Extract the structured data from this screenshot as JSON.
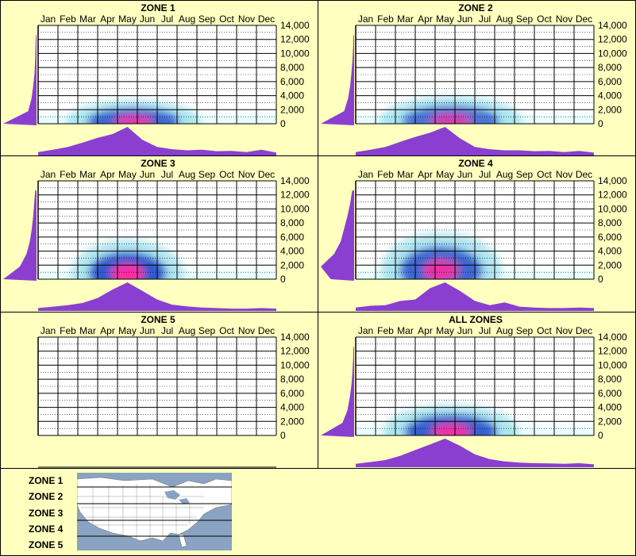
{
  "chart_data": [
    {
      "type": "heatmap",
      "title": "ZONE 1",
      "x_categories": [
        "Jan",
        "Feb",
        "Mar",
        "Apr",
        "May",
        "Jun",
        "Jul",
        "Aug",
        "Sep",
        "Oct",
        "Nov",
        "Dec"
      ],
      "y_ticks": [
        "14,000",
        "12,000",
        "10,000",
        "8,000",
        "6,000",
        "4,000",
        "2,000",
        "0"
      ],
      "ylim": [
        0,
        14000
      ],
      "hot_spot": {
        "month": 4.8,
        "value": 300,
        "intensity": 0.9,
        "spread_month": 1.8,
        "spread_value": 700
      },
      "top_marginal": [
        0.12,
        0.2,
        0.3,
        0.45,
        0.62,
        0.75,
        1.0,
        0.55,
        0.3,
        0.22,
        0.18,
        0.2,
        0.15,
        0.16,
        0.12,
        0.2,
        0.1
      ],
      "side_marginal": [
        1.0,
        0.25,
        0.15,
        0.1,
        0.06,
        0.04,
        0.03,
        0.02
      ]
    },
    {
      "type": "heatmap",
      "title": "ZONE 2",
      "x_categories": [
        "Jan",
        "Feb",
        "Mar",
        "Apr",
        "May",
        "Jun",
        "Jul",
        "Aug",
        "Sep",
        "Oct",
        "Nov",
        "Dec"
      ],
      "y_ticks": [
        "14,000",
        "12,000",
        "10,000",
        "8,000",
        "6,000",
        "4,000",
        "2,000",
        "0"
      ],
      "ylim": [
        0,
        14000
      ],
      "hot_spot": {
        "month": 4.8,
        "value": 400,
        "intensity": 0.8,
        "spread_month": 1.9,
        "spread_value": 900
      },
      "top_marginal": [
        0.12,
        0.2,
        0.3,
        0.48,
        0.65,
        0.8,
        1.0,
        0.6,
        0.3,
        0.22,
        0.18,
        0.18,
        0.15,
        0.16,
        0.12,
        0.16,
        0.1
      ],
      "side_marginal": [
        1.0,
        0.3,
        0.18,
        0.12,
        0.08,
        0.05,
        0.03,
        0.02
      ]
    },
    {
      "type": "heatmap",
      "title": "ZONE 3",
      "x_categories": [
        "Jan",
        "Feb",
        "Mar",
        "Apr",
        "May",
        "Jun",
        "Jul",
        "Aug",
        "Sep",
        "Oct",
        "Nov",
        "Dec"
      ],
      "y_ticks": [
        "14,000",
        "12,000",
        "10,000",
        "8,000",
        "6,000",
        "4,000",
        "2,000",
        "0"
      ],
      "ylim": [
        0,
        14000
      ],
      "hot_spot": {
        "month": 4.5,
        "value": 800,
        "intensity": 1.0,
        "spread_month": 1.5,
        "spread_value": 1500
      },
      "top_marginal": [
        0.1,
        0.15,
        0.2,
        0.28,
        0.45,
        0.75,
        1.0,
        0.7,
        0.4,
        0.22,
        0.16,
        0.12,
        0.1,
        0.08,
        0.08,
        0.1,
        0.08
      ],
      "side_marginal": [
        1.0,
        0.5,
        0.3,
        0.2,
        0.14,
        0.1,
        0.07,
        0.04
      ]
    },
    {
      "type": "heatmap",
      "title": "ZONE 4",
      "x_categories": [
        "Jan",
        "Feb",
        "Mar",
        "Apr",
        "May",
        "Jun",
        "Jul",
        "Aug",
        "Sep",
        "Oct",
        "Nov",
        "Dec"
      ],
      "y_ticks": [
        "14,000",
        "12,000",
        "10,000",
        "8,000",
        "6,000",
        "4,000",
        "2,000",
        "0"
      ],
      "ylim": [
        0,
        14000
      ],
      "hot_spot": {
        "month": 4.3,
        "value": 1200,
        "intensity": 0.9,
        "spread_month": 1.6,
        "spread_value": 1800
      },
      "top_marginal": [
        0.12,
        0.18,
        0.2,
        0.35,
        0.4,
        0.8,
        1.0,
        0.7,
        0.35,
        0.2,
        0.3,
        0.15,
        0.12,
        0.1,
        0.1,
        0.12,
        0.1
      ],
      "side_marginal": [
        0.7,
        1.0,
        0.6,
        0.4,
        0.3,
        0.2,
        0.12,
        0.06
      ]
    },
    {
      "type": "heatmap",
      "title": "ZONE 5",
      "x_categories": [
        "Jan",
        "Feb",
        "Mar",
        "Apr",
        "May",
        "Jun",
        "Jul",
        "Aug",
        "Sep",
        "Oct",
        "Nov",
        "Dec"
      ],
      "y_ticks": [
        "14,000",
        "12,000",
        "10,000",
        "8,000",
        "6,000",
        "4,000",
        "2,000",
        "0"
      ],
      "ylim": [
        0,
        14000
      ],
      "hot_spot": null,
      "top_marginal": [],
      "side_marginal": []
    },
    {
      "type": "heatmap",
      "title": "ALL ZONES",
      "x_categories": [
        "Jan",
        "Feb",
        "Mar",
        "Apr",
        "May",
        "Jun",
        "Jul",
        "Aug",
        "Sep",
        "Oct",
        "Nov",
        "Dec"
      ],
      "y_ticks": [
        "14,000",
        "12,000",
        "10,000",
        "8,000",
        "6,000",
        "4,000",
        "2,000",
        "0"
      ],
      "ylim": [
        0,
        14000
      ],
      "hot_spot": {
        "month": 4.8,
        "value": 500,
        "intensity": 0.95,
        "spread_month": 1.8,
        "spread_value": 1100
      },
      "top_marginal": [
        0.12,
        0.18,
        0.25,
        0.4,
        0.6,
        0.8,
        1.0,
        0.75,
        0.45,
        0.28,
        0.2,
        0.16,
        0.14,
        0.13,
        0.12,
        0.14,
        0.1
      ],
      "side_marginal": [
        1.0,
        0.35,
        0.2,
        0.13,
        0.08,
        0.05,
        0.03,
        0.02
      ]
    }
  ],
  "legend": {
    "zones": [
      "ZONE 1",
      "ZONE 2",
      "ZONE 3",
      "ZONE 4",
      "ZONE 5"
    ]
  },
  "colors": {
    "background": "#ffffc0",
    "marginal_fill": "#8a3fd1",
    "heat_low": "#e6ffff",
    "heat_mid": "#1a3fc8",
    "heat_high": "#ff2aa0",
    "map_water": "#8aa3c2",
    "map_land": "#ffffff"
  }
}
